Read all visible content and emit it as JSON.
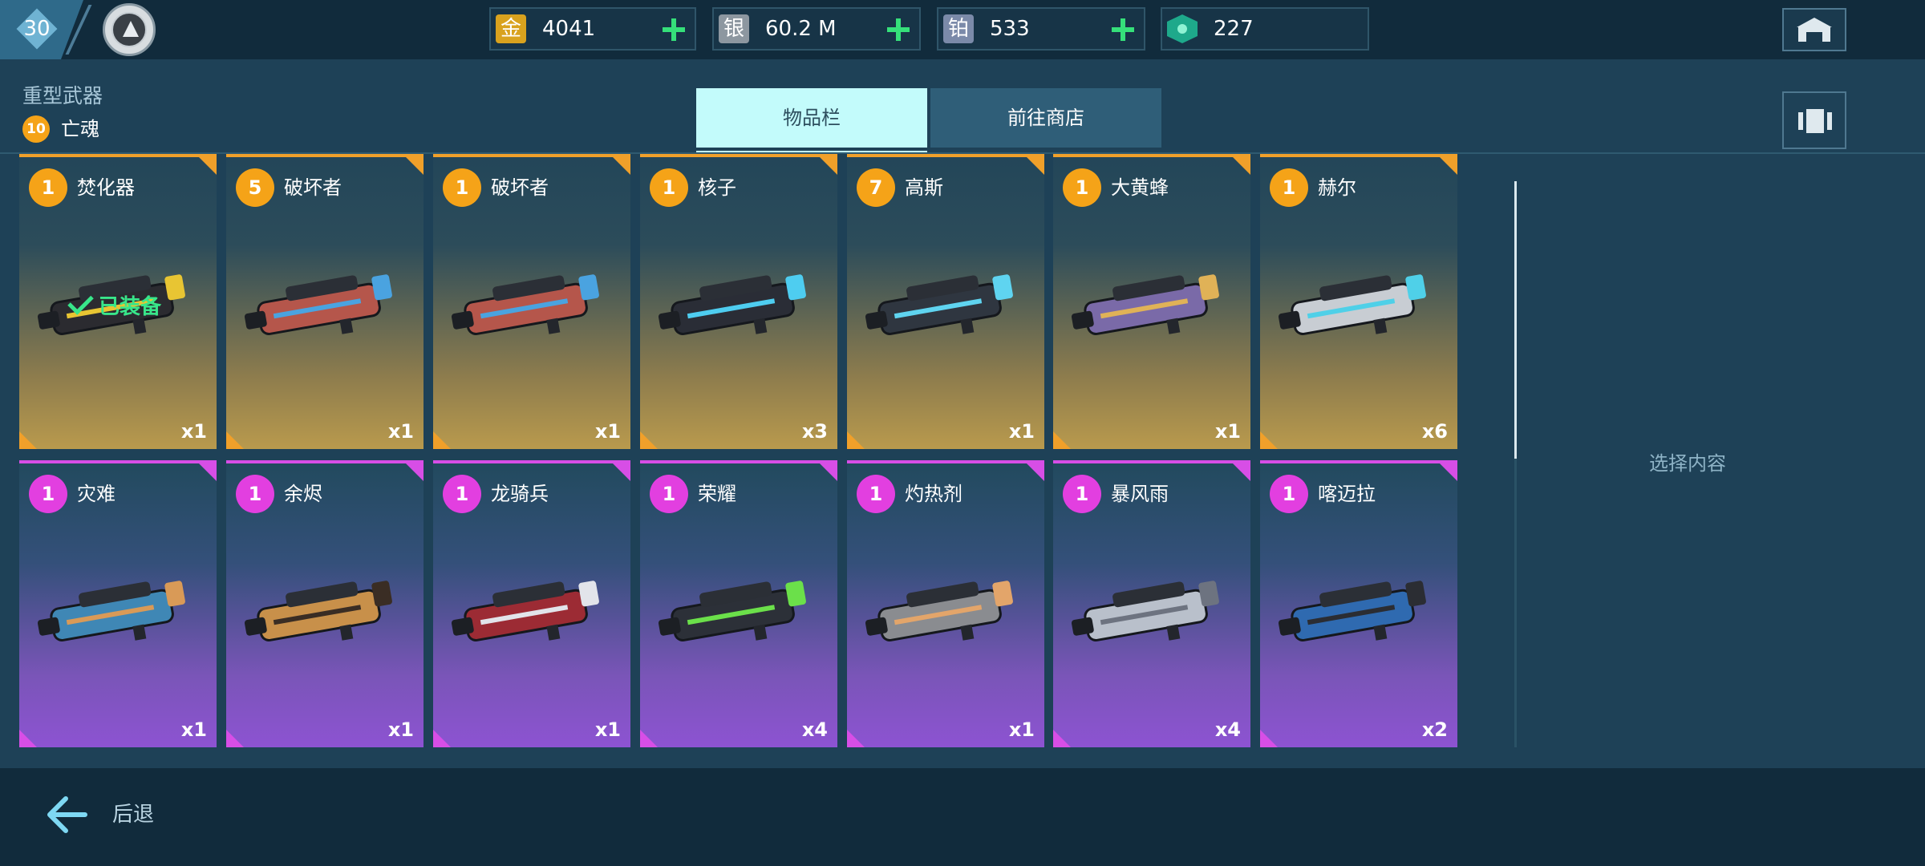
{
  "topbar": {
    "player_level": "30",
    "currencies": [
      {
        "id": "gold",
        "icon_char": "金",
        "value": "4041"
      },
      {
        "id": "silver",
        "icon_char": "银",
        "value": "60.2 M"
      },
      {
        "id": "platinum",
        "icon_char": "铂",
        "value": "533"
      },
      {
        "id": "gem",
        "icon_char": "",
        "value": "227"
      }
    ]
  },
  "header": {
    "category": "重型武器",
    "owner_level": "10",
    "owner_name": "亡魂"
  },
  "tabs": {
    "inventory": "物品栏",
    "shop": "前往商店"
  },
  "colors": {
    "gold_rarity": "#f0a02a",
    "purple_rarity": "#d74ee6",
    "plus_green": "#35e07a",
    "equipped_green": "#38e68a"
  },
  "items": [
    {
      "name": "焚化器",
      "level": "1",
      "qty": "x1",
      "rarity": "gold",
      "equipped_label": "已装备",
      "hull": "#2b2b30",
      "accent": "#e8c533"
    },
    {
      "name": "破坏者",
      "level": "5",
      "qty": "x1",
      "rarity": "gold",
      "hull": "#b5564b",
      "accent": "#4aa3e0"
    },
    {
      "name": "破坏者",
      "level": "1",
      "qty": "x1",
      "rarity": "gold",
      "hull": "#b5564b",
      "accent": "#4aa3e0"
    },
    {
      "name": "核子",
      "level": "1",
      "qty": "x3",
      "rarity": "gold",
      "hull": "#2a2d36",
      "accent": "#4ecdf0"
    },
    {
      "name": "高斯",
      "level": "7",
      "qty": "x1",
      "rarity": "gold",
      "hull": "#2f3640",
      "accent": "#5fd4f0"
    },
    {
      "name": "大黄蜂",
      "level": "1",
      "qty": "x1",
      "rarity": "gold",
      "hull": "#7a6aa8",
      "accent": "#e0b257"
    },
    {
      "name": "赫尔",
      "level": "1",
      "qty": "x6",
      "rarity": "gold",
      "hull": "#c8cdd3",
      "accent": "#4fd0e8"
    },
    {
      "name": "灾难",
      "level": "1",
      "qty": "x1",
      "rarity": "purple",
      "hull": "#3f87b5",
      "accent": "#d99a57"
    },
    {
      "name": "余烬",
      "level": "1",
      "qty": "x1",
      "rarity": "purple",
      "hull": "#c8904a",
      "accent": "#3a2d24"
    },
    {
      "name": "龙骑兵",
      "level": "1",
      "qty": "x1",
      "rarity": "purple",
      "hull": "#9c2b34",
      "accent": "#e2e4ea"
    },
    {
      "name": "荣耀",
      "level": "1",
      "qty": "x4",
      "rarity": "purple",
      "hull": "#2c3038",
      "accent": "#6be04a"
    },
    {
      "name": "灼热剂",
      "level": "1",
      "qty": "x1",
      "rarity": "purple",
      "hull": "#8a8c90",
      "accent": "#e3a56a"
    },
    {
      "name": "暴风雨",
      "level": "1",
      "qty": "x4",
      "rarity": "purple",
      "hull": "#b9c0cb",
      "accent": "#6d7380"
    },
    {
      "name": "喀迈拉",
      "level": "1",
      "qty": "x2",
      "rarity": "purple",
      "hull": "#2f6ab0",
      "accent": "#2b2d33"
    }
  ],
  "detail": {
    "placeholder": "选择内容"
  },
  "footer": {
    "back": "后退"
  }
}
